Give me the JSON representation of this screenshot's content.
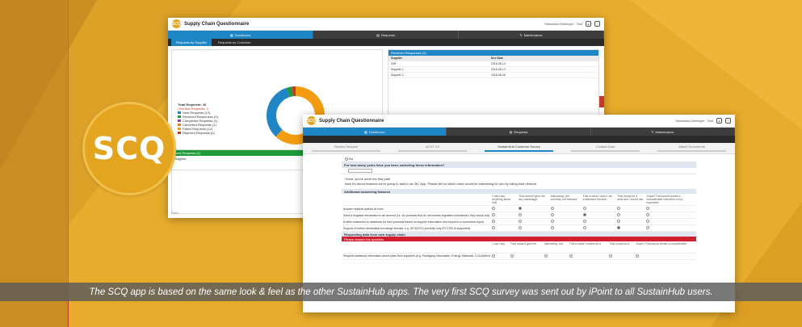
{
  "badge": {
    "label": "SCQ"
  },
  "caption": {
    "text": "The SCQ app is based on the same look & feel as the other SustainHub apps. The very first SCQ survey was sent out by iPoint to all SustainHub users."
  },
  "colors": {
    "background": "#e8ac2c",
    "accent_blue": "#1f86c6",
    "green": "#1e9a3a",
    "red": "#d0202f"
  },
  "window1": {
    "logo": "SCQ",
    "title": "Supply Chain Questionnaire",
    "user": "Sebastian Dehlinger - Test",
    "nav": [
      {
        "label": "Dashboard",
        "icon": "dashboard-icon"
      },
      {
        "label": "Requests",
        "icon": "inbox-icon"
      },
      {
        "label": "Maintenance",
        "icon": "wrench-icon"
      }
    ],
    "subtabs": [
      "Requests by Supplier",
      "Requests by Customer"
    ],
    "legend": {
      "title": "Total Requests: 16",
      "subtitle": "Overdue Requests: 4",
      "items": [
        {
          "label": "Sent Requests (13)",
          "color": "#1f86c6"
        },
        {
          "label": "Received Responses (0)",
          "color": "#1e9a3a"
        },
        {
          "label": "Completed Requests (1)",
          "color": "#8e44ad"
        },
        {
          "label": "Cancelled Requests (1)",
          "color": "#e67e22"
        },
        {
          "label": "Failed Requests (12)",
          "color": "#f39c12"
        },
        {
          "label": "Rejected Requests (0)",
          "color": "#c0392b"
        }
      ]
    },
    "donut": {
      "segments": [
        {
          "value": 62,
          "color": "#f39c12"
        },
        {
          "value": 33,
          "color": "#1f86c6"
        },
        {
          "value": 3,
          "color": "#1e9a3a"
        },
        {
          "value": 2,
          "color": "#c0392b"
        }
      ]
    },
    "received_panel": {
      "header": "Received Responses (2)",
      "columns": [
        "Supplier",
        "Due Date"
      ],
      "rows": [
        {
          "name": "X59",
          "date": "2016-06-13"
        },
        {
          "name": "Supplier 1",
          "date": "2016-06-13"
        },
        {
          "name": "Supplier 2",
          "date": "2016-06-26"
        }
      ]
    },
    "lower_panel": {
      "header": "Sent Requests (1)",
      "row": "Supplier"
    },
    "filter": "Filter"
  },
  "window2": {
    "logo": "SCQ",
    "title": "Supply Chain Questionnaire",
    "user": "Sebastian Dehlinger - Test",
    "nav": [
      {
        "label": "Dashboard",
        "icon": "dashboard-icon"
      },
      {
        "label": "Requests",
        "icon": "inbox-icon"
      },
      {
        "label": "Maintenance",
        "icon": "wrench-icon"
      }
    ],
    "steps": [
      "Review Request",
      "eLIST 3.0",
      "SustainHub Customer Survey",
      "Contact Data",
      "Attach Documents"
    ],
    "active_step": 2,
    "q_no": "No",
    "q_header": "For how many years have you been collecting these information?",
    "intro_line1": "Great, you're done the first part!",
    "intro_line2": "Now it's about features we're going to add to our BC App. Please tell us which ones would be interesting for you by rating each feature.",
    "section1": "Additional answering features",
    "matrix_cols": [
      "I can't say anything about that",
      "That doesn't give me any advantage",
      "Interesting, but currently not relevant",
      "This is what I need / as a standard function",
      "That would be a deal and I would use",
      "Super! That would create a considerable reduction of my expenses"
    ],
    "matrix_rows": [
      {
        "label": "Answer multiple queries at once",
        "sel": 1
      },
      {
        "label": "Send a negative declaration to an amount (i.e. for products that do not contain regulated substances; they would only have to make the statement that a product do not have any significant hazards effect on the environment)",
        "sel": 3
      },
      {
        "label": "Enable customers to data/tools for their products based on supplier information and export to a customers report",
        "sel": -1
      },
      {
        "label": "Support of further declaration exchange formats, e.g. IEC62474 (currently only IPC1752 is supported)",
        "sel": 4
      }
    ],
    "section2": "Requesting data from own supply chain",
    "red_bar": "Please answer the question",
    "matrix2_cols": [
      "I can't say",
      "That doesn't give me",
      "Interesting, but",
      "This is what I expect as a",
      "That would be a",
      "Super! That would create a considerable"
    ],
    "bottom_row": "Request additional information about parts from suppliers (e.g. Packaging information, Energy, Materials, LCA information)"
  }
}
